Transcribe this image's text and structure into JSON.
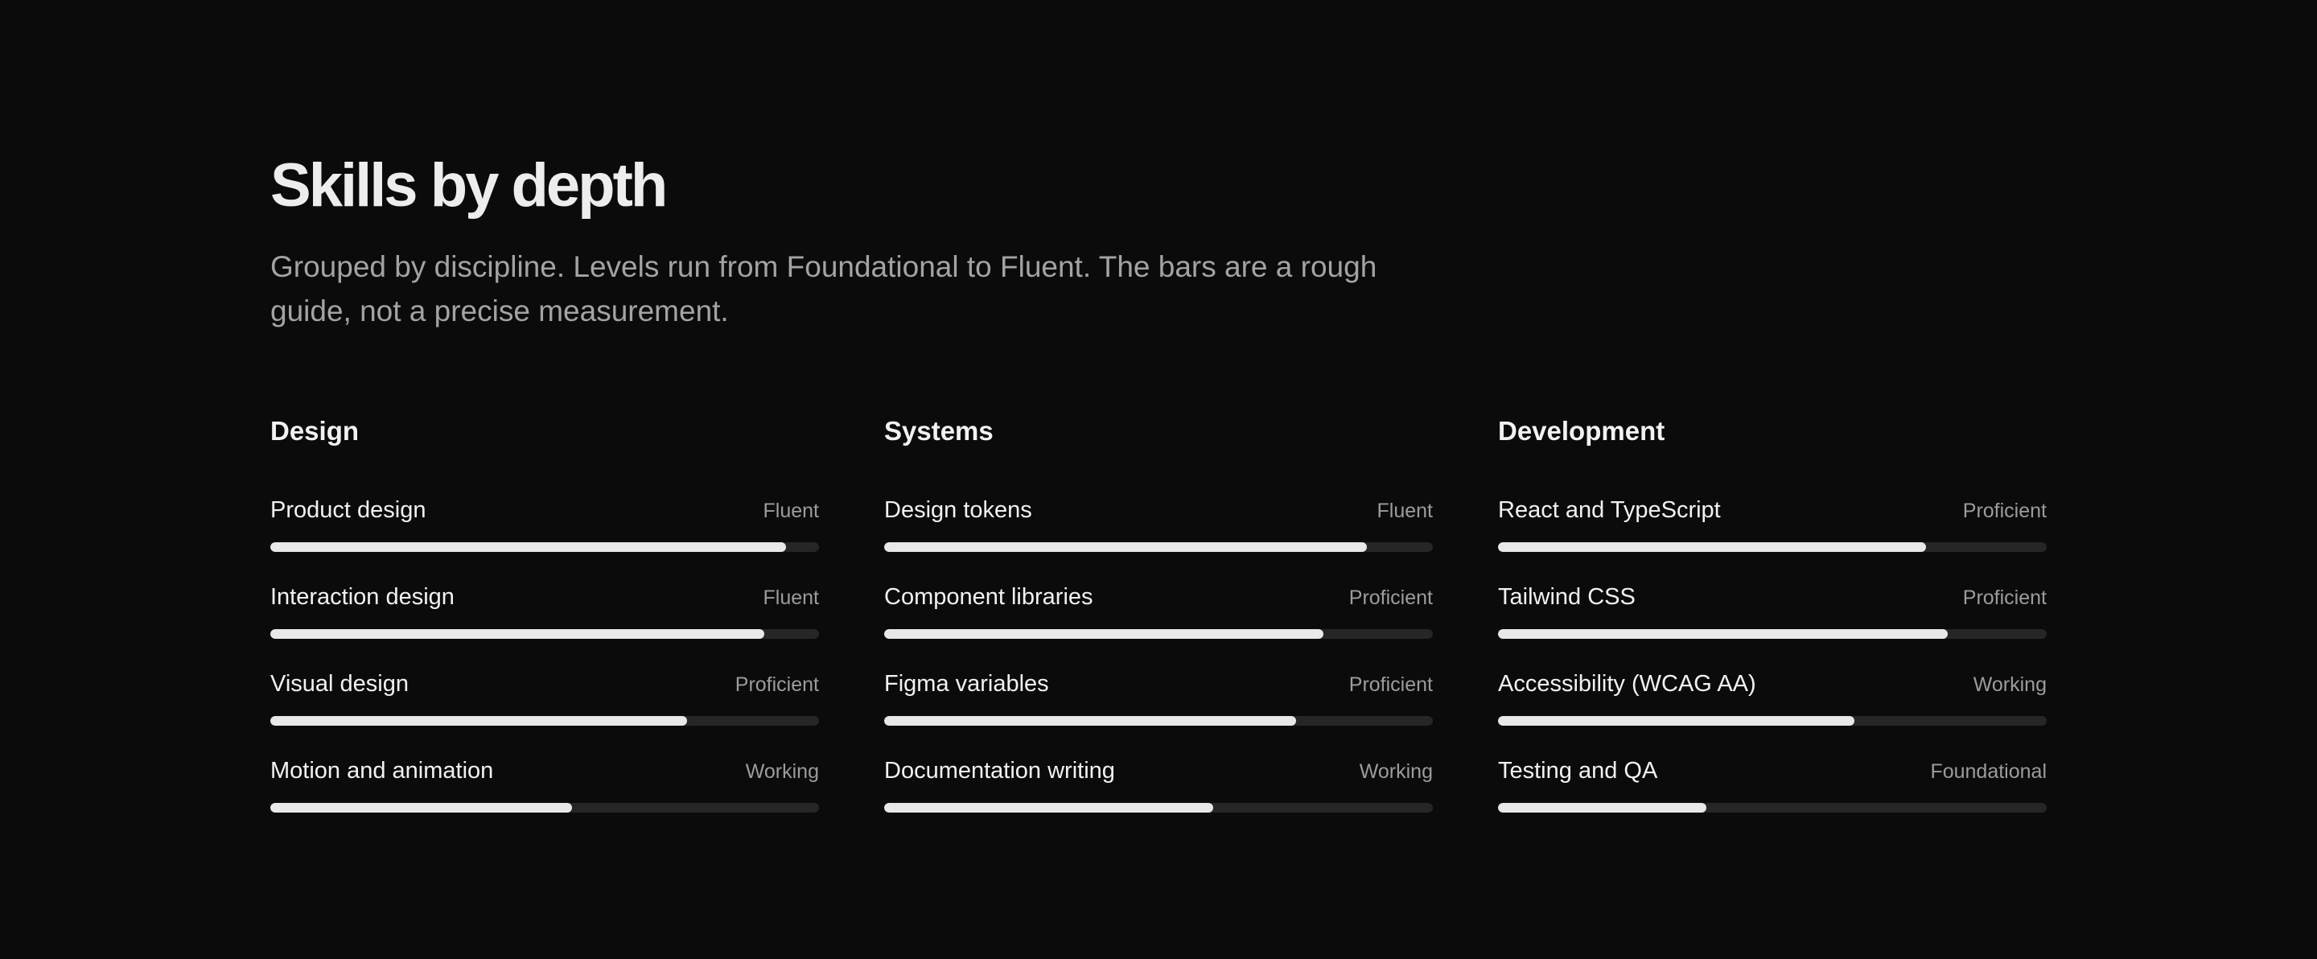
{
  "header": {
    "title": "Skills by depth",
    "subtitle": "Grouped by discipline. Levels run from Foundational to Fluent. The bars are a rough guide, not a precise measurement."
  },
  "colors": {
    "background": "#0b0b0b",
    "bar_fill": "#e8e8e8",
    "bar_track": "#262626",
    "muted_text": "#a3a3a3"
  },
  "columns": [
    {
      "heading": "Design",
      "skills": [
        {
          "name": "Product design",
          "level": "Fluent",
          "fill_percent": 94
        },
        {
          "name": "Interaction design",
          "level": "Fluent",
          "fill_percent": 90
        },
        {
          "name": "Visual design",
          "level": "Proficient",
          "fill_percent": 76
        },
        {
          "name": "Motion and animation",
          "level": "Working",
          "fill_percent": 55
        }
      ]
    },
    {
      "heading": "Systems",
      "skills": [
        {
          "name": "Design tokens",
          "level": "Fluent",
          "fill_percent": 88
        },
        {
          "name": "Component libraries",
          "level": "Proficient",
          "fill_percent": 80
        },
        {
          "name": "Figma variables",
          "level": "Proficient",
          "fill_percent": 75
        },
        {
          "name": "Documentation writing",
          "level": "Working",
          "fill_percent": 60
        }
      ]
    },
    {
      "heading": "Development",
      "skills": [
        {
          "name": "React and TypeScript",
          "level": "Proficient",
          "fill_percent": 78
        },
        {
          "name": "Tailwind CSS",
          "level": "Proficient",
          "fill_percent": 82
        },
        {
          "name": "Accessibility (WCAG AA)",
          "level": "Working",
          "fill_percent": 65
        },
        {
          "name": "Testing and QA",
          "level": "Foundational",
          "fill_percent": 38
        }
      ]
    }
  ]
}
